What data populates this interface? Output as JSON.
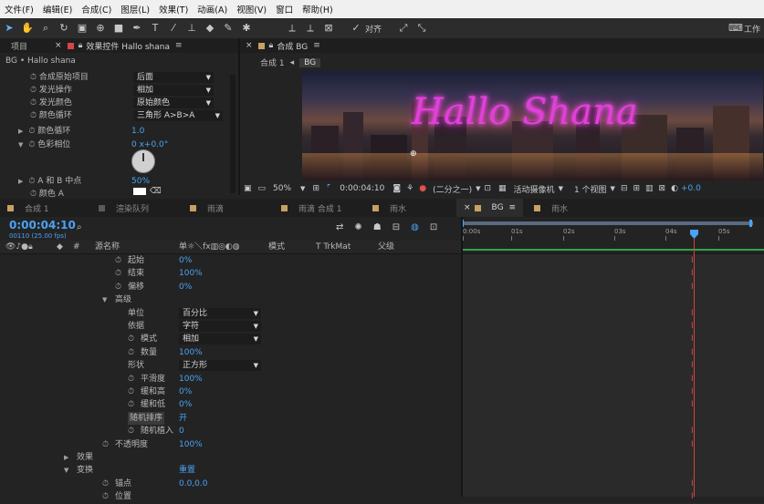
{
  "menu": [
    "文件(F)",
    "编辑(E)",
    "合成(C)",
    "图层(L)",
    "效果(T)",
    "动画(A)",
    "视图(V)",
    "窗口",
    "帮助(H)"
  ],
  "toolbar": {
    "snap_label": "对齐",
    "work_label": "工作"
  },
  "effects_panel": {
    "tab_project": "项目",
    "tab_effects": "效果控件 Hallo shana",
    "breadcrumb": "BG • Hallo shana",
    "rows": [
      {
        "label": "合成原始项目",
        "value": "后面"
      },
      {
        "label": "发光操作",
        "value": "相加"
      },
      {
        "label": "发光颜色",
        "value": "原始颜色"
      },
      {
        "label": "颜色循环",
        "value": "三角形 A>B>A"
      },
      {
        "label": "颜色循环",
        "value": "1.0"
      },
      {
        "label": "色彩相位",
        "value": "0 x+0.0°"
      },
      {
        "label": "A 和 B 中点",
        "value": "50%"
      },
      {
        "label": "颜色 A",
        "value": ""
      }
    ]
  },
  "composition": {
    "tab": "合成 BG",
    "breadcrumb": [
      "合成 1",
      "BG"
    ],
    "preview_text": "Hallo Shana",
    "zoom": "50%",
    "timecode": "0:00:04:10",
    "resolution": "(二分之一)",
    "camera": "活动摄像机",
    "views": "1 个视图",
    "exposure": "+0.0"
  },
  "timeline": {
    "tabs": [
      "合成 1",
      "渲染队列",
      "雨滴",
      "雨滴 合成 1",
      "雨水",
      "BG",
      "雨水"
    ],
    "active_tab": "BG",
    "timecode": "0:00:04:10",
    "frames": "00110 (25.00 fps)",
    "search_placeholder": "",
    "col_source": "源名称",
    "col_mode": "模式",
    "col_trkmat": "T TrkMat",
    "col_parent": "父级",
    "ruler": [
      "0:00s",
      "01s",
      "02s",
      "03s",
      "04s",
      "05s"
    ],
    "rows": [
      {
        "label": "起始",
        "value": "0%",
        "indent": 2,
        "stopwatch": true
      },
      {
        "label": "结束",
        "value": "100%",
        "indent": 2,
        "stopwatch": true
      },
      {
        "label": "偏移",
        "value": "0%",
        "indent": 2,
        "stopwatch": true
      },
      {
        "label": "高级",
        "value": "",
        "indent": 1,
        "twirl": true
      },
      {
        "label": "单位",
        "value": "百分比",
        "indent": 3,
        "dropdown": true
      },
      {
        "label": "依据",
        "value": "字符",
        "indent": 3,
        "dropdown": true
      },
      {
        "label": "模式",
        "value": "相加",
        "indent": 3,
        "dropdown": true,
        "stopwatch": true
      },
      {
        "label": "数量",
        "value": "100%",
        "indent": 3,
        "stopwatch": true
      },
      {
        "label": "形状",
        "value": "正方形",
        "indent": 3,
        "dropdown": true
      },
      {
        "label": "平滑度",
        "value": "100%",
        "indent": 3,
        "stopwatch": true
      },
      {
        "label": "缓和高",
        "value": "0%",
        "indent": 3,
        "stopwatch": true
      },
      {
        "label": "缓和低",
        "value": "0%",
        "indent": 3,
        "stopwatch": true
      },
      {
        "label": "随机排序",
        "value": "开",
        "indent": 3,
        "highlight": true
      },
      {
        "label": "随机植入",
        "value": "0",
        "indent": 3,
        "stopwatch": true
      },
      {
        "label": "不透明度",
        "value": "100%",
        "indent": 1,
        "stopwatch": true
      },
      {
        "label": "效果",
        "value": "",
        "indent": 0,
        "twirl": true,
        "collapsed": true
      },
      {
        "label": "变换",
        "value": "重置",
        "indent": 0,
        "twirl": true
      },
      {
        "label": "锚点",
        "value": "0.0,0.0",
        "indent": 1,
        "stopwatch": true
      },
      {
        "label": "位置",
        "value": "",
        "indent": 1,
        "stopwatch": true
      }
    ]
  },
  "colors": {
    "accent": "#4aa3f5",
    "neon": "#e23fd8",
    "playhead": "#4aa3f5",
    "keyframe": "#e04848"
  }
}
